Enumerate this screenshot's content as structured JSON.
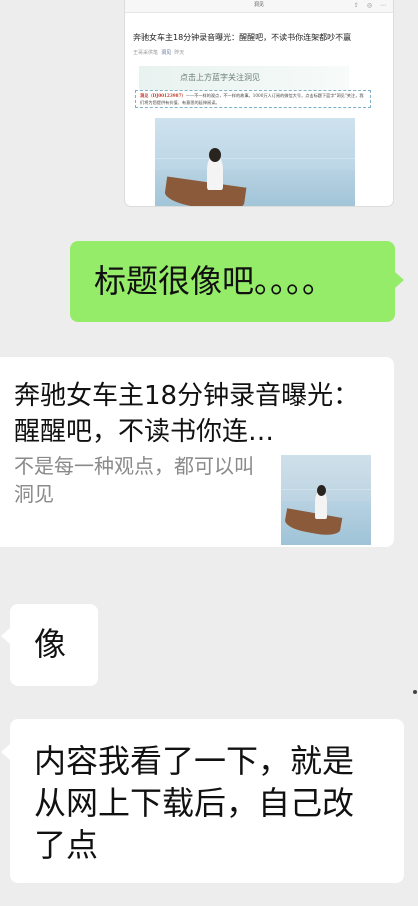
{
  "shared_image": {
    "top_title": "洞见",
    "top_icons": "⇪ ◎ ⋯",
    "article_title": "奔驰女车主18分钟录音曝光：醒醒吧，不读书你连架都吵不赢",
    "meta_source": "王哥采供笔",
    "meta_account": "洞见",
    "meta_suffix": "昨天",
    "banner_text": "点击上方蓝字关注洞见",
    "intro_prefix": "洞见",
    "intro_id": "（DJ00123987）",
    "intro_text": "——不一样的观点，不一样的故事。1000万人订阅的微信大号，点击标题下蓝字\"洞见\"关注，我们将为您提供有价值、有意思的延伸阅读。"
  },
  "messages": {
    "sent_text": "标题很像吧。。。。",
    "link_card": {
      "title": "奔驰女车主18分钟录音曝光：醒醒吧，不读书你连…",
      "description": "不是每一种观点，都可以叫洞见"
    },
    "reply_short": "像",
    "reply_long": "内容我看了一下，就是从网上下载后，自己改了点"
  },
  "colors": {
    "background": "#ededed",
    "sent_bubble": "#95ec69",
    "received_bubble": "#ffffff"
  }
}
